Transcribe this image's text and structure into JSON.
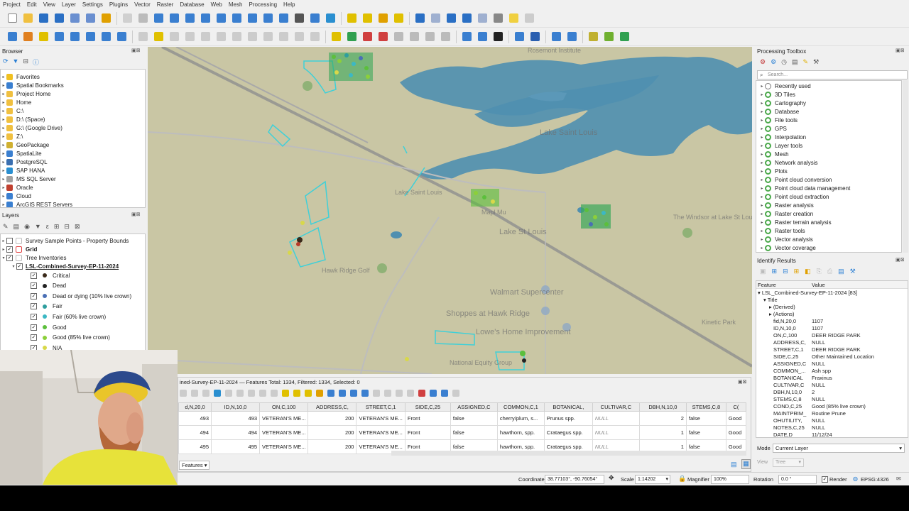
{
  "menu": [
    "Project",
    "Edit",
    "View",
    "Layer",
    "Settings",
    "Plugins",
    "Vector",
    "Raster",
    "Database",
    "Web",
    "Mesh",
    "Processing",
    "Help"
  ],
  "browser": {
    "title": "Browser",
    "items": [
      "Favorites",
      "Spatial Bookmarks",
      "Project Home",
      "Home",
      "C:\\",
      "D:\\ (Space)",
      "G:\\ (Google Drive)",
      "Z:\\",
      "GeoPackage",
      "SpatiaLite",
      "PostgreSQL",
      "SAP HANA",
      "MS SQL Server",
      "Oracle",
      "Cloud",
      "ArcGIS REST Servers"
    ]
  },
  "layers": {
    "title": "Layers",
    "items": [
      {
        "label": "Survey Sample Points - Property Bounds",
        "checked": false,
        "bold": false
      },
      {
        "label": "Grid",
        "checked": true,
        "bold": true
      },
      {
        "label": "Tree Inventories",
        "checked": true,
        "bold": false
      },
      {
        "label": "LSL-Combined-Survey-EP-11-2024",
        "checked": true,
        "bold": true
      }
    ],
    "classes": [
      {
        "label": "Critical",
        "color": "#3a2a1a"
      },
      {
        "label": "Dead",
        "color": "#222222"
      },
      {
        "label": "Dead or dying (10% live crown)",
        "color": "#4a6fb5"
      },
      {
        "label": "Fair",
        "color": "#2e9e9e"
      },
      {
        "label": "Fair (60% live crown)",
        "color": "#3cb8c4"
      },
      {
        "label": "Good",
        "color": "#5cbf3c"
      },
      {
        "label": "Good (85% live crown)",
        "color": "#8ccf3a"
      },
      {
        "label": "N/A",
        "color": "#d8d84a"
      }
    ]
  },
  "map": {
    "labels": [
      "Lake Saint Louis",
      "Lake St Louis",
      "Walmart Supercenter",
      "Shoppes at Hawk Ridge",
      "Lowe's Home Improvement",
      "Hawk Ridge Golf",
      "Lake Saint Louis",
      "The Windsor at Lake St Louis",
      "Kinetic Park",
      "Rosemont Institute",
      "National Equity Group",
      "Mapl Mu"
    ]
  },
  "processing": {
    "title": "Processing Toolbox",
    "search_placeholder": "Search...",
    "items": [
      "Recently used",
      "3D Tiles",
      "Cartography",
      "Database",
      "File tools",
      "GPS",
      "Interpolation",
      "Layer tools",
      "Mesh",
      "Network analysis",
      "Plots",
      "Point cloud conversion",
      "Point cloud data management",
      "Point cloud extraction",
      "Raster analysis",
      "Raster creation",
      "Raster terrain analysis",
      "Raster tools",
      "Vector analysis",
      "Vector coverage"
    ]
  },
  "identify": {
    "title": "Identify Results",
    "col_feature": "Feature",
    "col_value": "Value",
    "layer": "LSL_Combined-Survey-EP-11-2024 [83]",
    "title_node": "Title",
    "derived": "(Derived)",
    "actions": "(Actions)",
    "rows": [
      {
        "k": "fid,N,20,0",
        "v": "1107"
      },
      {
        "k": "ID,N,10,0",
        "v": "1107"
      },
      {
        "k": "ON,C,100",
        "v": "DEER RIDGE PARK"
      },
      {
        "k": "ADDRESS,C,",
        "v": "NULL"
      },
      {
        "k": "STREET,C,1",
        "v": "DEER RIDGE PARK"
      },
      {
        "k": "SIDE,C,25",
        "v": "Other Maintained Location"
      },
      {
        "k": "ASSIGNED,C",
        "v": "NULL"
      },
      {
        "k": "COMMON_...",
        "v": "Ash spp"
      },
      {
        "k": "BOTANICAL",
        "v": "Fraxinus"
      },
      {
        "k": "CULTIVAR,C",
        "v": "NULL"
      },
      {
        "k": "DBH,N,10,0",
        "v": "2"
      },
      {
        "k": "STEMS,C,8",
        "v": "NULL"
      },
      {
        "k": "COND,C,25",
        "v": "Good (85% live crown)"
      },
      {
        "k": "MAINTPRIM_",
        "v": "Routine Prune"
      },
      {
        "k": "OHUTILITY,",
        "v": "NULL"
      },
      {
        "k": "NOTES,C,25",
        "v": "NULL"
      },
      {
        "k": "DATE,D",
        "v": "11/12/24"
      }
    ],
    "mode_label": "Mode",
    "mode_value": "Current Layer",
    "view_label": "View",
    "view_value": "Tree"
  },
  "attribute_table": {
    "title": "ined-Survey-EP-11-2024 — Features Total: 1334, Filtered: 1334, Selected: 0",
    "columns": [
      "d,N,20,0",
      "ID,N,10,0",
      "ON,C,100",
      "ADDRESS,C,",
      "STREET,C,1",
      "SIDE,C,25",
      "ASSIGNED,C",
      "COMMON,C,1",
      "BOTANICAL,",
      "CULTIVAR,C",
      "DBH,N,10,0",
      "STEMS,C,8",
      "C("
    ],
    "rows": [
      [
        "493",
        "493",
        "VETERAN'S ME...",
        "200",
        "VETERAN'S ME...",
        "Front",
        "false",
        "cherry/plum, s...",
        "Prunus spp.",
        "NULL",
        "2",
        "false",
        "Good"
      ],
      [
        "494",
        "494",
        "VETERAN'S ME...",
        "200",
        "VETERAN'S ME...",
        "Front",
        "false",
        "hawthorn, spp.",
        "Crataegus spp.",
        "NULL",
        "1",
        "false",
        "Good"
      ],
      [
        "495",
        "495",
        "VETERAN'S ME...",
        "200",
        "VETERAN'S ME...",
        "Front",
        "false",
        "hawthorn, spp.",
        "Crataegus spp.",
        "NULL",
        "1",
        "false",
        "Good"
      ]
    ],
    "footer_tab": "Features"
  },
  "status": {
    "coordinate_label": "Coordinate",
    "coordinate_value": "38.77103°, -90.76054°",
    "scale_label": "Scale",
    "scale_value": "1:14202",
    "magnifier_label": "Magnifier",
    "magnifier_value": "100%",
    "rotation_label": "Rotation",
    "rotation_value": "0.0 °",
    "render_label": "Render",
    "crs": "EPSG:4326"
  },
  "colors": {
    "map_bg": "#c9c6a4",
    "water": "#4f8fb0",
    "road": "#a9a9a9",
    "cyan_bounds": "#3fd0d8"
  }
}
